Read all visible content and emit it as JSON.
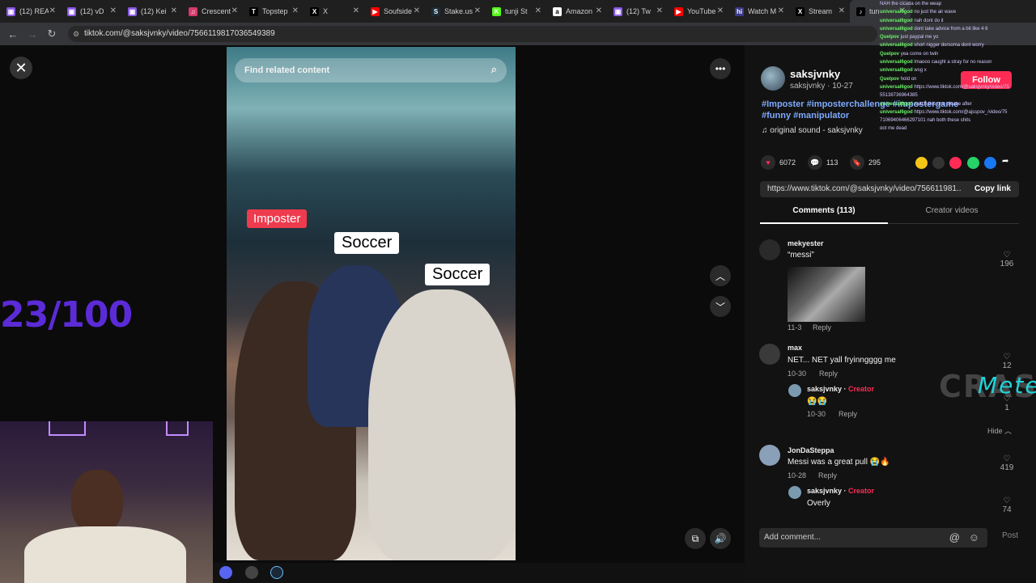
{
  "browser": {
    "tabs": [
      {
        "title": "(12) REAL",
        "color": "#8957e5",
        "glyph": "▣"
      },
      {
        "title": "(12) vD",
        "color": "#8957e5",
        "glyph": "▣"
      },
      {
        "title": "(12) Kei",
        "color": "#8957e5",
        "glyph": "▣"
      },
      {
        "title": "Crescent",
        "color": "#d63a6b",
        "glyph": "♫"
      },
      {
        "title": "Topstep",
        "color": "#000000",
        "glyph": "T"
      },
      {
        "title": "X",
        "color": "#000000",
        "glyph": "X"
      },
      {
        "title": "Soufside",
        "color": "#ff0000",
        "glyph": "▶"
      },
      {
        "title": "Stake.us",
        "color": "#1a2c38",
        "glyph": "S"
      },
      {
        "title": "tunji St",
        "color": "#53fc18",
        "glyph": "K"
      },
      {
        "title": "Amazon",
        "color": "#ffffff",
        "glyph": "a"
      },
      {
        "title": "(12) Tw",
        "color": "#8957e5",
        "glyph": "▣"
      },
      {
        "title": "YouTube",
        "color": "#ff0000",
        "glyph": "▶"
      },
      {
        "title": "Watch M",
        "color": "#3a3a8a",
        "glyph": "hi"
      },
      {
        "title": "Stream",
        "color": "#000000",
        "glyph": "X"
      },
      {
        "title": "tun",
        "color": "#000000",
        "glyph": "♪"
      }
    ],
    "url": "tiktok.com/@saksjvnky/video/7566119817036549389"
  },
  "video": {
    "search_placeholder": "Find related content",
    "labels": {
      "imposter": "Imposter",
      "soccer1": "Soccer",
      "soccer2": "Soccer"
    }
  },
  "overlay": {
    "counter": "23/100",
    "crash_text": "CRASH",
    "crash_sub": "Meter"
  },
  "author": {
    "name": "saksjvnky",
    "meta": "saksjvnky · 10-27",
    "follow": "Follow",
    "hashtags": "#Imposter #imposterchallenge #impostergame #funny #manipulator",
    "sound": "♫ original sound - saksjvnky"
  },
  "stats": {
    "likes": "6072",
    "comments": "113",
    "saves": "295"
  },
  "link": {
    "url": "https://www.tiktok.com/@saksjvnky/video/756611981...",
    "copy": "Copy link"
  },
  "tabs": {
    "comments": "Comments (113)",
    "creator": "Creator videos"
  },
  "comments": [
    {
      "user": "mekyester",
      "text": "“messi”",
      "meta": "11-3",
      "reply": "Reply",
      "likes": "196"
    },
    {
      "user": "max",
      "text": "NET... NET yall fryinngggg me",
      "meta": "10-30",
      "reply": "Reply",
      "likes": "12"
    },
    {
      "user": "saksjvnky",
      "creator": "Creator",
      "text": "😭😭",
      "meta": "10-30",
      "reply": "Reply",
      "likes": "1"
    },
    {
      "user": "JonDaSteppa",
      "text": "Messi was a great pull 😭🔥",
      "meta": "10-28",
      "reply": "Reply",
      "likes": "419"
    },
    {
      "user": "saksjvnky",
      "creator": "Creator",
      "text": "Overly",
      "likes": "74"
    }
  ],
  "hide_label": "Hide",
  "add_comment": {
    "placeholder": "Add comment...",
    "post": "Post"
  },
  "chat": [
    {
      "user": "",
      "msg": "NAH the cicada on the weap"
    },
    {
      "user": "universal6god",
      "msg": "no just the air wave"
    },
    {
      "user": "universal6god",
      "msg": "nah dont do it"
    },
    {
      "user": "universal6god",
      "msg": "dont take advice from a bit like 4 6"
    },
    {
      "user": "Quelpov",
      "msg": "just paypal me yo"
    },
    {
      "user": "universal6god",
      "msg": "short nigger dorsoma dont worry"
    },
    {
      "user": "Quelpov",
      "msg": "yea come on twin"
    },
    {
      "user": "universal6god",
      "msg": "lmaooo caught a stray for no reason"
    },
    {
      "user": "universal6god",
      "msg": "wsg x"
    },
    {
      "user": "Quelpov",
      "msg": "hold on"
    },
    {
      "user": "universal6god",
      "msg": "https://www.tiktok.com/@saksjvnky/video/75"
    },
    {
      "user": "",
      "msg": "55138736964385"
    },
    {
      "user": "universal6god",
      "msg": "watch this one please after"
    },
    {
      "user": "universal6god",
      "msg": "https://www.tiktok.com/@ajsspov_/video/75"
    },
    {
      "user": "",
      "msg": "71069406466297101 nah both these shits"
    },
    {
      "user": "",
      "msg": "got me dead"
    }
  ]
}
